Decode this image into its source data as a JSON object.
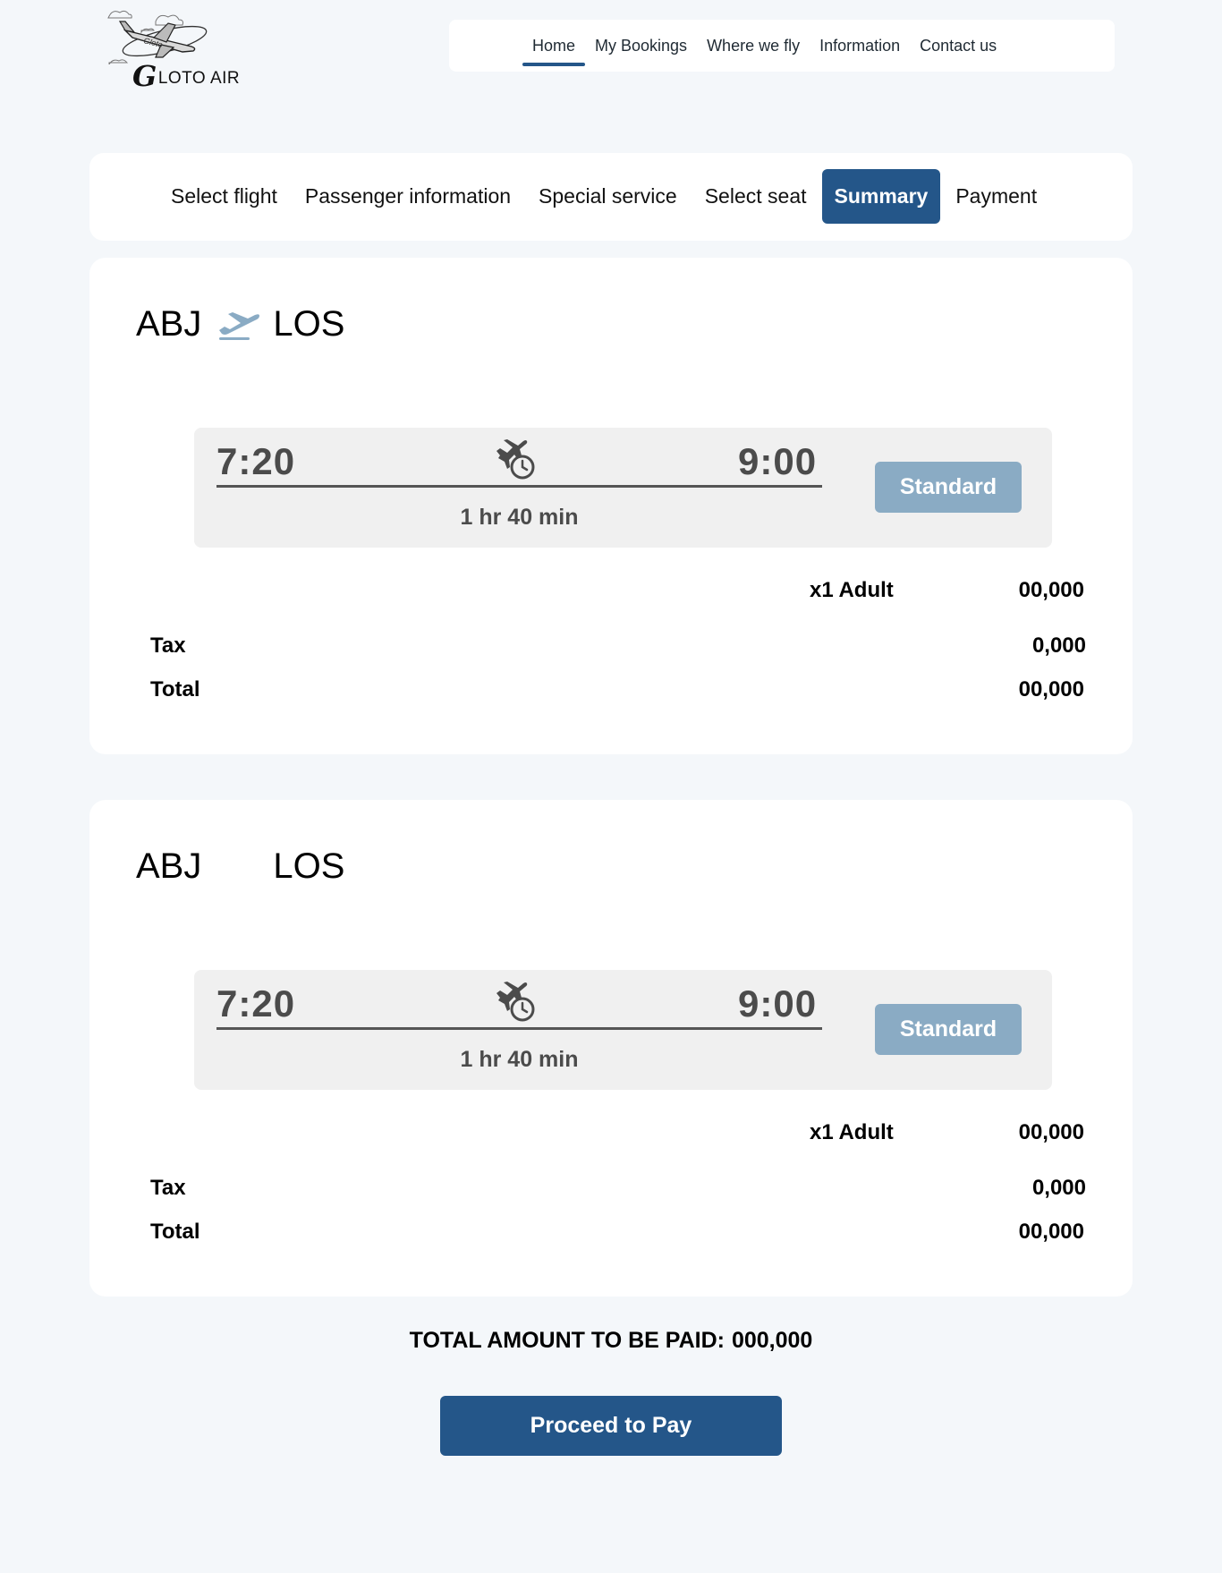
{
  "brand": {
    "logo_plane_text": "Gloto",
    "logo_initial": "G",
    "logo_text": "LOTO AIR"
  },
  "nav": {
    "items": [
      {
        "label": "Home",
        "active": true
      },
      {
        "label": "My Bookings"
      },
      {
        "label": "Where we fly"
      },
      {
        "label": "Information"
      },
      {
        "label": "Contact us"
      }
    ],
    "accent": "#245689"
  },
  "steps": {
    "items": [
      {
        "label": "Select flight"
      },
      {
        "label": "Passenger information"
      },
      {
        "label": "Special service"
      },
      {
        "label": "Select seat"
      },
      {
        "label": "Summary",
        "active": true
      },
      {
        "label": "Payment"
      }
    ]
  },
  "flights": [
    {
      "origin": "ABJ",
      "destination": "LOS",
      "route_icon": "airplane-takeoff-icon",
      "departure": "7:20",
      "arrival": "9:00",
      "duration": "1 hr 40 min",
      "duration_icon": "flight-time-icon",
      "fare_class": "Standard",
      "passengers_label": "x1 Adult",
      "passengers_amount": "00,000",
      "tax_label": "Tax",
      "tax_amount": "0,000",
      "total_label": "Total",
      "total_amount": "00,000"
    },
    {
      "origin": "ABJ",
      "destination": "LOS",
      "route_icon": null,
      "departure": "7:20",
      "arrival": "9:00",
      "duration": "1 hr 40 min",
      "duration_icon": "flight-time-icon",
      "fare_class": "Standard",
      "passengers_label": "x1 Adult",
      "passengers_amount": "00,000",
      "tax_label": "Tax",
      "tax_amount": "0,000",
      "total_label": "Total",
      "total_amount": "00,000"
    }
  ],
  "summary": {
    "total_label": "TOTAL AMOUNT TO BE PAID:",
    "total_value": "000,000",
    "pay_button": "Proceed to Pay"
  },
  "colors": {
    "primary": "#245689",
    "fare_button": "#8aabc4",
    "background": "#f4f7fa"
  }
}
